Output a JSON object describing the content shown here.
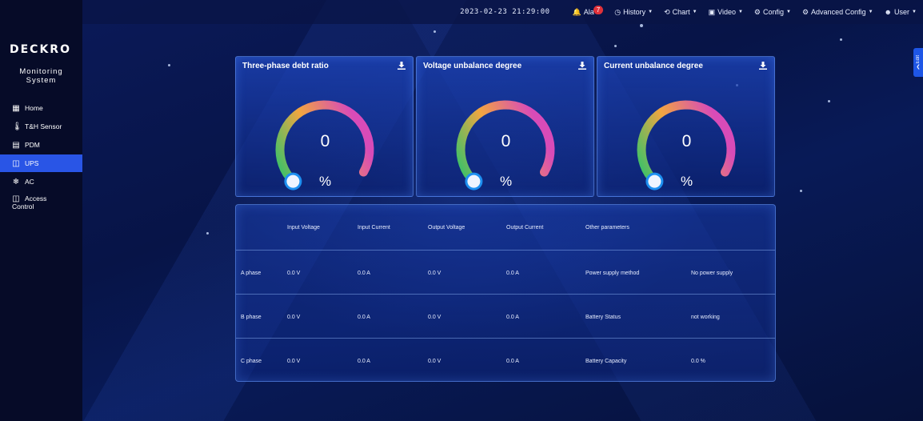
{
  "topbar": {
    "datetime": "2023-02-23 21:29:00",
    "alarm": {
      "label": "Ala",
      "count": "7"
    },
    "menus": [
      {
        "icon": "history-icon",
        "label": "History"
      },
      {
        "icon": "chart-icon",
        "label": "Chart"
      },
      {
        "icon": "video-icon",
        "label": "Video"
      },
      {
        "icon": "config-icon",
        "label": "Config"
      },
      {
        "icon": "advanced-config-icon",
        "label": "Advanced Config"
      },
      {
        "icon": "user-icon",
        "label": "User"
      }
    ]
  },
  "sidebar": {
    "logo": "DECKRO",
    "system_title_1": "Monitoring",
    "system_title_2": "System",
    "items": [
      {
        "label": "Home",
        "icon": "grid-icon"
      },
      {
        "label": "T&H Sensor",
        "icon": "thermometer-icon"
      },
      {
        "label": "PDM",
        "icon": "pdm-icon"
      },
      {
        "label": "UPS",
        "icon": "ups-icon"
      },
      {
        "label": "AC",
        "icon": "snowflake-icon"
      },
      {
        "label": "Access",
        "label2": "Control",
        "icon": "door-icon"
      }
    ],
    "active_item": "UPS"
  },
  "side_tab": {
    "label": "Edit"
  },
  "gauges": [
    {
      "title": "Three-phase debt ratio",
      "value": "0",
      "unit": "%",
      "level": 0
    },
    {
      "title": "Voltage unbalance degree",
      "value": "0",
      "unit": "%",
      "level": 0
    },
    {
      "title": "Current unbalance degree",
      "value": "0",
      "unit": "%",
      "level": 0
    }
  ],
  "table": {
    "headers": [
      "",
      "Input Voltage",
      "Input Current",
      "Output Voltage",
      "Output Current",
      "Other parameters",
      ""
    ],
    "rows": [
      {
        "phase": "A phase",
        "input_voltage": "0.0 V",
        "input_current": "0.0 A",
        "output_voltage": "0.0 V",
        "output_current": "0.0 A",
        "param_name": "Power supply method",
        "param_value": "No power supply"
      },
      {
        "phase": "B phase",
        "input_voltage": "0.0 V",
        "input_current": "0.0 A",
        "output_voltage": "0.0 V",
        "output_current": "0.0 A",
        "param_name": "Battery Status",
        "param_value": "not working"
      },
      {
        "phase": "C phase",
        "input_voltage": "0.0 V",
        "input_current": "0.0 A",
        "output_voltage": "0.0 V",
        "output_current": "0.0 A",
        "param_name": "Battery Capacity",
        "param_value": "0.0 %"
      }
    ]
  },
  "colors": {
    "accent": "#2955e6",
    "badge": "#e0313a",
    "gauge_start": "#2ec36b",
    "gauge_mid": "#f2a640",
    "gauge_end": "#d84bb8"
  }
}
